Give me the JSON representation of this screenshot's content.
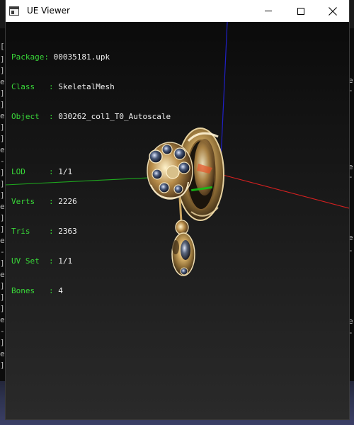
{
  "window": {
    "title": "UE Viewer",
    "icons": {
      "app": "app-window-icon",
      "minimize": "minimize-icon",
      "maximize": "maximize-icon",
      "close": "close-icon"
    }
  },
  "info": {
    "package": {
      "label": "Package: ",
      "value": "00035181.upk"
    },
    "class": {
      "label": "Class   : ",
      "value": "SkeletalMesh"
    },
    "object": {
      "label": "Object  : ",
      "value": "030262_col1_T0_Autoscale"
    },
    "lod": {
      "label": "LOD     : ",
      "value": "1/1"
    },
    "verts": {
      "label": "Verts   : ",
      "value": "2226"
    },
    "tris": {
      "label": "Tris    : ",
      "value": "2363"
    },
    "uvset": {
      "label": "UV Set  : ",
      "value": "1/1"
    },
    "bones": {
      "label": "Bones   : ",
      "value": "4"
    }
  },
  "colors": {
    "label_green": "#39d839",
    "value_white": "#f0f0f0",
    "axis_x": "#d42020",
    "axis_y": "#1ea81e",
    "axis_z": "#2020c8"
  }
}
